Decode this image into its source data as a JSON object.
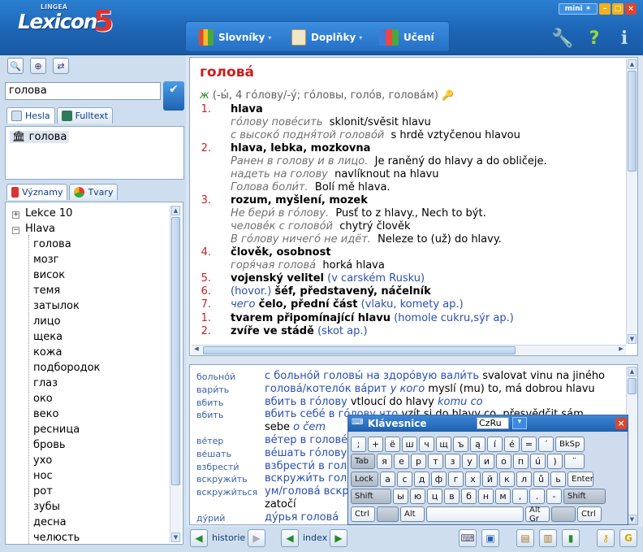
{
  "app": {
    "logo_text": "Lexicon",
    "logo_number": "5",
    "logo_brand": "LINGEA"
  },
  "window_controls": {
    "mini": "mini"
  },
  "toolbar": {
    "slovniky": "Slovníky",
    "doplnky": "Doplňky",
    "uceni": "Učení"
  },
  "search": {
    "value": "голова"
  },
  "search_tabs": [
    {
      "label": "Hesla"
    },
    {
      "label": "Fulltext"
    }
  ],
  "hits": [
    {
      "label": "голова"
    }
  ],
  "tree_tabs": [
    {
      "label": "Významy"
    },
    {
      "label": "Tvary"
    }
  ],
  "tree": {
    "groups": [
      {
        "label": "Lekce 10",
        "expanded": false
      },
      {
        "label": "Hlava",
        "expanded": true
      }
    ],
    "items": [
      "голова",
      "мозг",
      "висок",
      "темя",
      "затылок",
      "лицо",
      "щека",
      "кожа",
      "подбородок",
      "глаз",
      "око",
      "веко",
      "ресница",
      "бровь",
      "ухо",
      "нос",
      "рот",
      "зубы",
      "десна",
      "челюсть"
    ]
  },
  "entry": {
    "headword": "головá",
    "grammar_gender": "ж",
    "grammar_rest": "(-ы́, 4 го́лову/-у́; го́ловы, голо́в, головáм)",
    "senses": [
      {
        "n": "1.",
        "text": "hlava",
        "examples": [
          {
            "ru": "го́лову пове́сить",
            "cz": "sklonit/svěsit hlavu"
          },
          {
            "ru": "с высоко́ подня́той голово́й",
            "cz": "s hrdě vztyčenou hlavou"
          }
        ]
      },
      {
        "n": "2.",
        "text": "hlava, lebka, mozkovna",
        "examples": [
          {
            "ru": "Ранен в голову и в лицо.",
            "cz": "Je raněný do hlavy a do obličeje."
          },
          {
            "ru": "надеть на голову",
            "cz": "navlíknout na hlavu"
          },
          {
            "ru": "Голова боли́т.",
            "cz": "Bolí mě hlava."
          }
        ]
      },
      {
        "n": "3.",
        "text": "rozum, myšlení, mozek",
        "examples": [
          {
            "ru": "Не бери́ в го́лову.",
            "cz": "Pusť to z hlavy., Nech to být."
          },
          {
            "ru": "челове́к с голово́й",
            "cz": "chytrý člověk"
          },
          {
            "ru": "В го́лову ничего́ не идёт.",
            "cz": "Neleze to (už) do hlavy."
          }
        ]
      },
      {
        "n": "4.",
        "text": "člověk, osobnost",
        "examples": [
          {
            "ru": "горя́чая голова́",
            "cz": "horká hlava"
          }
        ]
      },
      {
        "n": "5.",
        "text": "vojenský velitel",
        "note": "(v carském Rusku)"
      },
      {
        "n": "6.",
        "pre": "(hovor.)",
        "text": "šéf, představený, náčelník"
      },
      {
        "n": "7.",
        "pre": "чего",
        "text": "čelo, přední část",
        "note": "(vlaku, komety ap.)"
      }
    ],
    "senses2": [
      {
        "n": "1.",
        "text": "tvarem připomínající hlavu",
        "note": "(homole cukru,sýr ap.)"
      },
      {
        "n": "2.",
        "text": "zvíře ve stádě",
        "note": "(skot ap.)"
      }
    ]
  },
  "phrases": [
    {
      "key": "больно́й",
      "ru": "с больно́й головы́ на здоро́вую вали́ть",
      "cz": "svalovat vinu na jiného"
    },
    {
      "key": "вари́ть",
      "ru": "голова́/котело́к ва́рит",
      "ru_i": "у кого",
      "cz": "myslí (mu) to, má dobrou hlavu"
    },
    {
      "key": "вбить",
      "ru": "вбить в го́лову",
      "cz": "vtloucí do hlavy",
      "cz_i": "komu co"
    },
    {
      "key": "вбить",
      "ru": "вбить себе́ в го́лову что",
      "cz": "vzít si do hlavy co, přesvědčit sám"
    },
    {
      "key": "",
      "ru": "",
      "cz": "sebe",
      "cz_i": "o čem"
    },
    {
      "key": "ве́тер",
      "ru": "ве́тер в голове́",
      "cz": ""
    },
    {
      "key": "ве́шать",
      "ru": "ве́шать го́лову",
      "cz": ""
    },
    {
      "key": "взбрести́",
      "ru": "взбрести́ в гол",
      "cz": ""
    },
    {
      "key": "вскружи́ть",
      "ru": "вскружи́ть гол",
      "cz": ""
    },
    {
      "key": "вскружи́ться",
      "ru": "ум/голова́ вскр",
      "cz": ""
    },
    {
      "key": "",
      "ru": "",
      "cz": "zatočí"
    },
    {
      "key": "ду́рий",
      "ru": "ду́рья голова́",
      "cz": ""
    }
  ],
  "bottombar": {
    "historie": "historie",
    "index": "index"
  },
  "keyboard": {
    "title": "Klávesnice",
    "layout": "CzRu",
    "row1": [
      ";",
      "+",
      "ё",
      "ш",
      "ч",
      "щ",
      "ъ",
      "ą",
      "í",
      "é",
      "=",
      "´",
      "BkSp"
    ],
    "row2": [
      "Tab",
      "я",
      "е",
      "р",
      "т",
      "з",
      "у",
      "и",
      "о",
      "п",
      "ú",
      ")",
      "¨"
    ],
    "row3": [
      "Lock",
      "а",
      "с",
      "д",
      "ф",
      "г",
      "х",
      "й",
      "к",
      "л",
      "ů",
      "ь",
      "Enter"
    ],
    "row4": [
      "Shift",
      "ы",
      "ю",
      "ц",
      "в",
      "б",
      "н",
      "м",
      ",",
      ".",
      "-",
      "Shift"
    ],
    "row5": [
      "Ctrl",
      "Alt",
      "",
      "Alt Gr",
      "Ctrl"
    ]
  }
}
